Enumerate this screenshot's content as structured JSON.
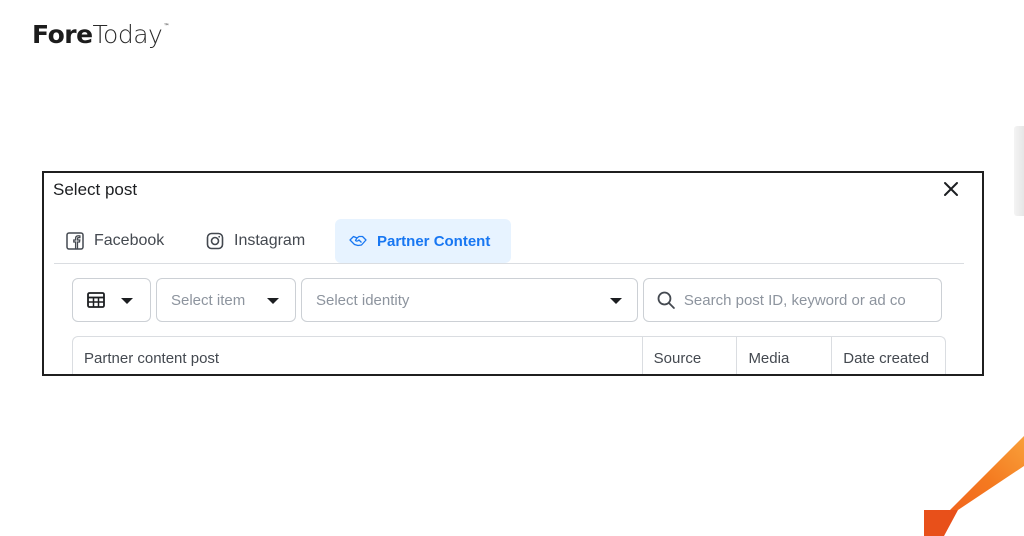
{
  "brand": {
    "name_bold": "Fore",
    "name_light": "Today",
    "trademark": "™",
    "accent_color": "#f26522"
  },
  "dialog": {
    "title": "Select post",
    "close_icon": "close-icon",
    "tabs": [
      {
        "label": "Facebook",
        "icon": "facebook-icon",
        "active": false
      },
      {
        "label": "Instagram",
        "icon": "instagram-icon",
        "active": false
      },
      {
        "label": "Partner Content",
        "icon": "handshake-icon",
        "active": true
      }
    ],
    "filters": {
      "view_icon": "table-grid-icon",
      "select_item_placeholder": "Select item",
      "select_identity_placeholder": "Select identity",
      "search_placeholder": "Search post ID, keyword or ad co"
    },
    "table": {
      "columns": [
        "Partner content post",
        "Source",
        "Media",
        "Date created"
      ]
    }
  },
  "colors": {
    "active_tab_bg": "#e7f3ff",
    "active_tab_text": "#1877f2",
    "border": "#dadde1"
  }
}
